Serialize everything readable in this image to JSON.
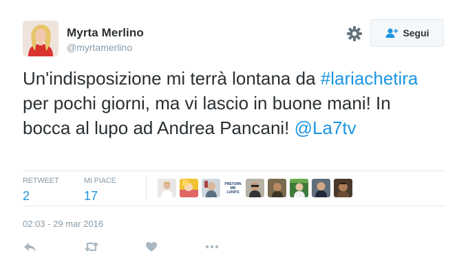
{
  "author": {
    "name": "Myrta Merlino",
    "handle": "@myrtamerlino"
  },
  "follow_button": {
    "label": "Segui",
    "icon": "follow-user-icon"
  },
  "settings_icon": "gear-icon",
  "tweet": {
    "text_parts": [
      {
        "type": "text",
        "value": "Un'indisposizione mi terrà lontana da "
      },
      {
        "type": "hashtag",
        "value": "#lariachetira"
      },
      {
        "type": "text",
        "value": " per pochi giorni, ma vi lascio in buone mani! In bocca al lupo ad Andrea Pancani! "
      },
      {
        "type": "mention",
        "value": "@La7tv"
      }
    ]
  },
  "stats": {
    "retweet": {
      "label": "RETWEET",
      "count": "2"
    },
    "likes": {
      "label": "MI PIACE",
      "count": "17"
    }
  },
  "likers": [
    {
      "name": "liker-1"
    },
    {
      "name": "liker-2"
    },
    {
      "name": "liker-3"
    },
    {
      "name": "liker-4",
      "text": "PRETURN MR LUNITS"
    },
    {
      "name": "liker-5"
    },
    {
      "name": "liker-6"
    },
    {
      "name": "liker-7"
    },
    {
      "name": "liker-8"
    },
    {
      "name": "liker-9"
    }
  ],
  "timestamp": "02:03 - 29 mar 2016",
  "actions": [
    "reply-icon",
    "retweet-icon",
    "like-icon",
    "more-icon"
  ],
  "colors": {
    "link": "#1b95e0",
    "text": "#292f33",
    "muted": "#8899a6",
    "border": "#e1e8ed",
    "action_icon": "#aab8c2"
  }
}
